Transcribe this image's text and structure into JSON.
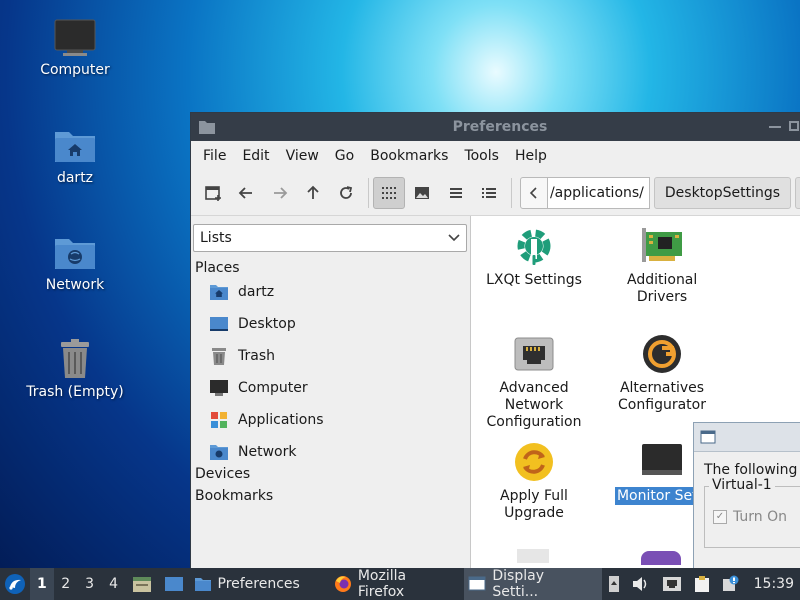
{
  "desktop": {
    "icons": [
      {
        "label": "Computer"
      },
      {
        "label": "dartz"
      },
      {
        "label": "Network"
      },
      {
        "label": "Trash (Empty)"
      }
    ]
  },
  "window": {
    "title": "Preferences",
    "menu": [
      "File",
      "Edit",
      "View",
      "Go",
      "Bookmarks",
      "Tools",
      "Help"
    ],
    "path": {
      "current_segment": "/applications/",
      "next_segment": "DesktopSettings"
    },
    "side_pane": {
      "mode": "Lists",
      "places_header": "Places",
      "places": [
        {
          "label": "dartz",
          "icon": "home-folder-icon"
        },
        {
          "label": "Desktop",
          "icon": "desktop-icon"
        },
        {
          "label": "Trash",
          "icon": "trash-icon"
        },
        {
          "label": "Computer",
          "icon": "computer-icon"
        },
        {
          "label": "Applications",
          "icon": "applications-icon"
        },
        {
          "label": "Network",
          "icon": "network-folder-icon"
        }
      ],
      "devices_header": "Devices",
      "bookmarks_header": "Bookmarks"
    },
    "items": [
      {
        "label": "LXQt Settings",
        "icon": "lxqt-settings-icon"
      },
      {
        "label": "Additional Drivers",
        "icon": "drivers-card-icon"
      },
      {
        "label": "Advanced Network Configuration",
        "icon": "network-port-icon"
      },
      {
        "label": "Alternatives Configurator",
        "icon": "alternatives-icon"
      },
      {
        "label": "Apply Full Upgrade",
        "icon": "upgrade-icon"
      },
      {
        "label": "Monitor Setti",
        "icon": "monitor-icon",
        "selected": true
      }
    ]
  },
  "dialog": {
    "text": "The following",
    "group_title": "Virtual-1",
    "checkbox_label": "Turn On"
  },
  "taskbar": {
    "workspaces": [
      "1",
      "2",
      "3",
      "4"
    ],
    "active_workspace": "1",
    "tasks": [
      {
        "label": "Preferences",
        "icon": "folder-icon"
      },
      {
        "label": "Mozilla Firefox",
        "icon": "firefox-icon"
      },
      {
        "label": "Display Setti...",
        "icon": "display-icon",
        "active": true
      }
    ],
    "clock": "15:39"
  },
  "colors": {
    "selection": "#3d84cf",
    "taskbar_bg": "#2a323c",
    "titlebar_bg": "#353d48"
  }
}
